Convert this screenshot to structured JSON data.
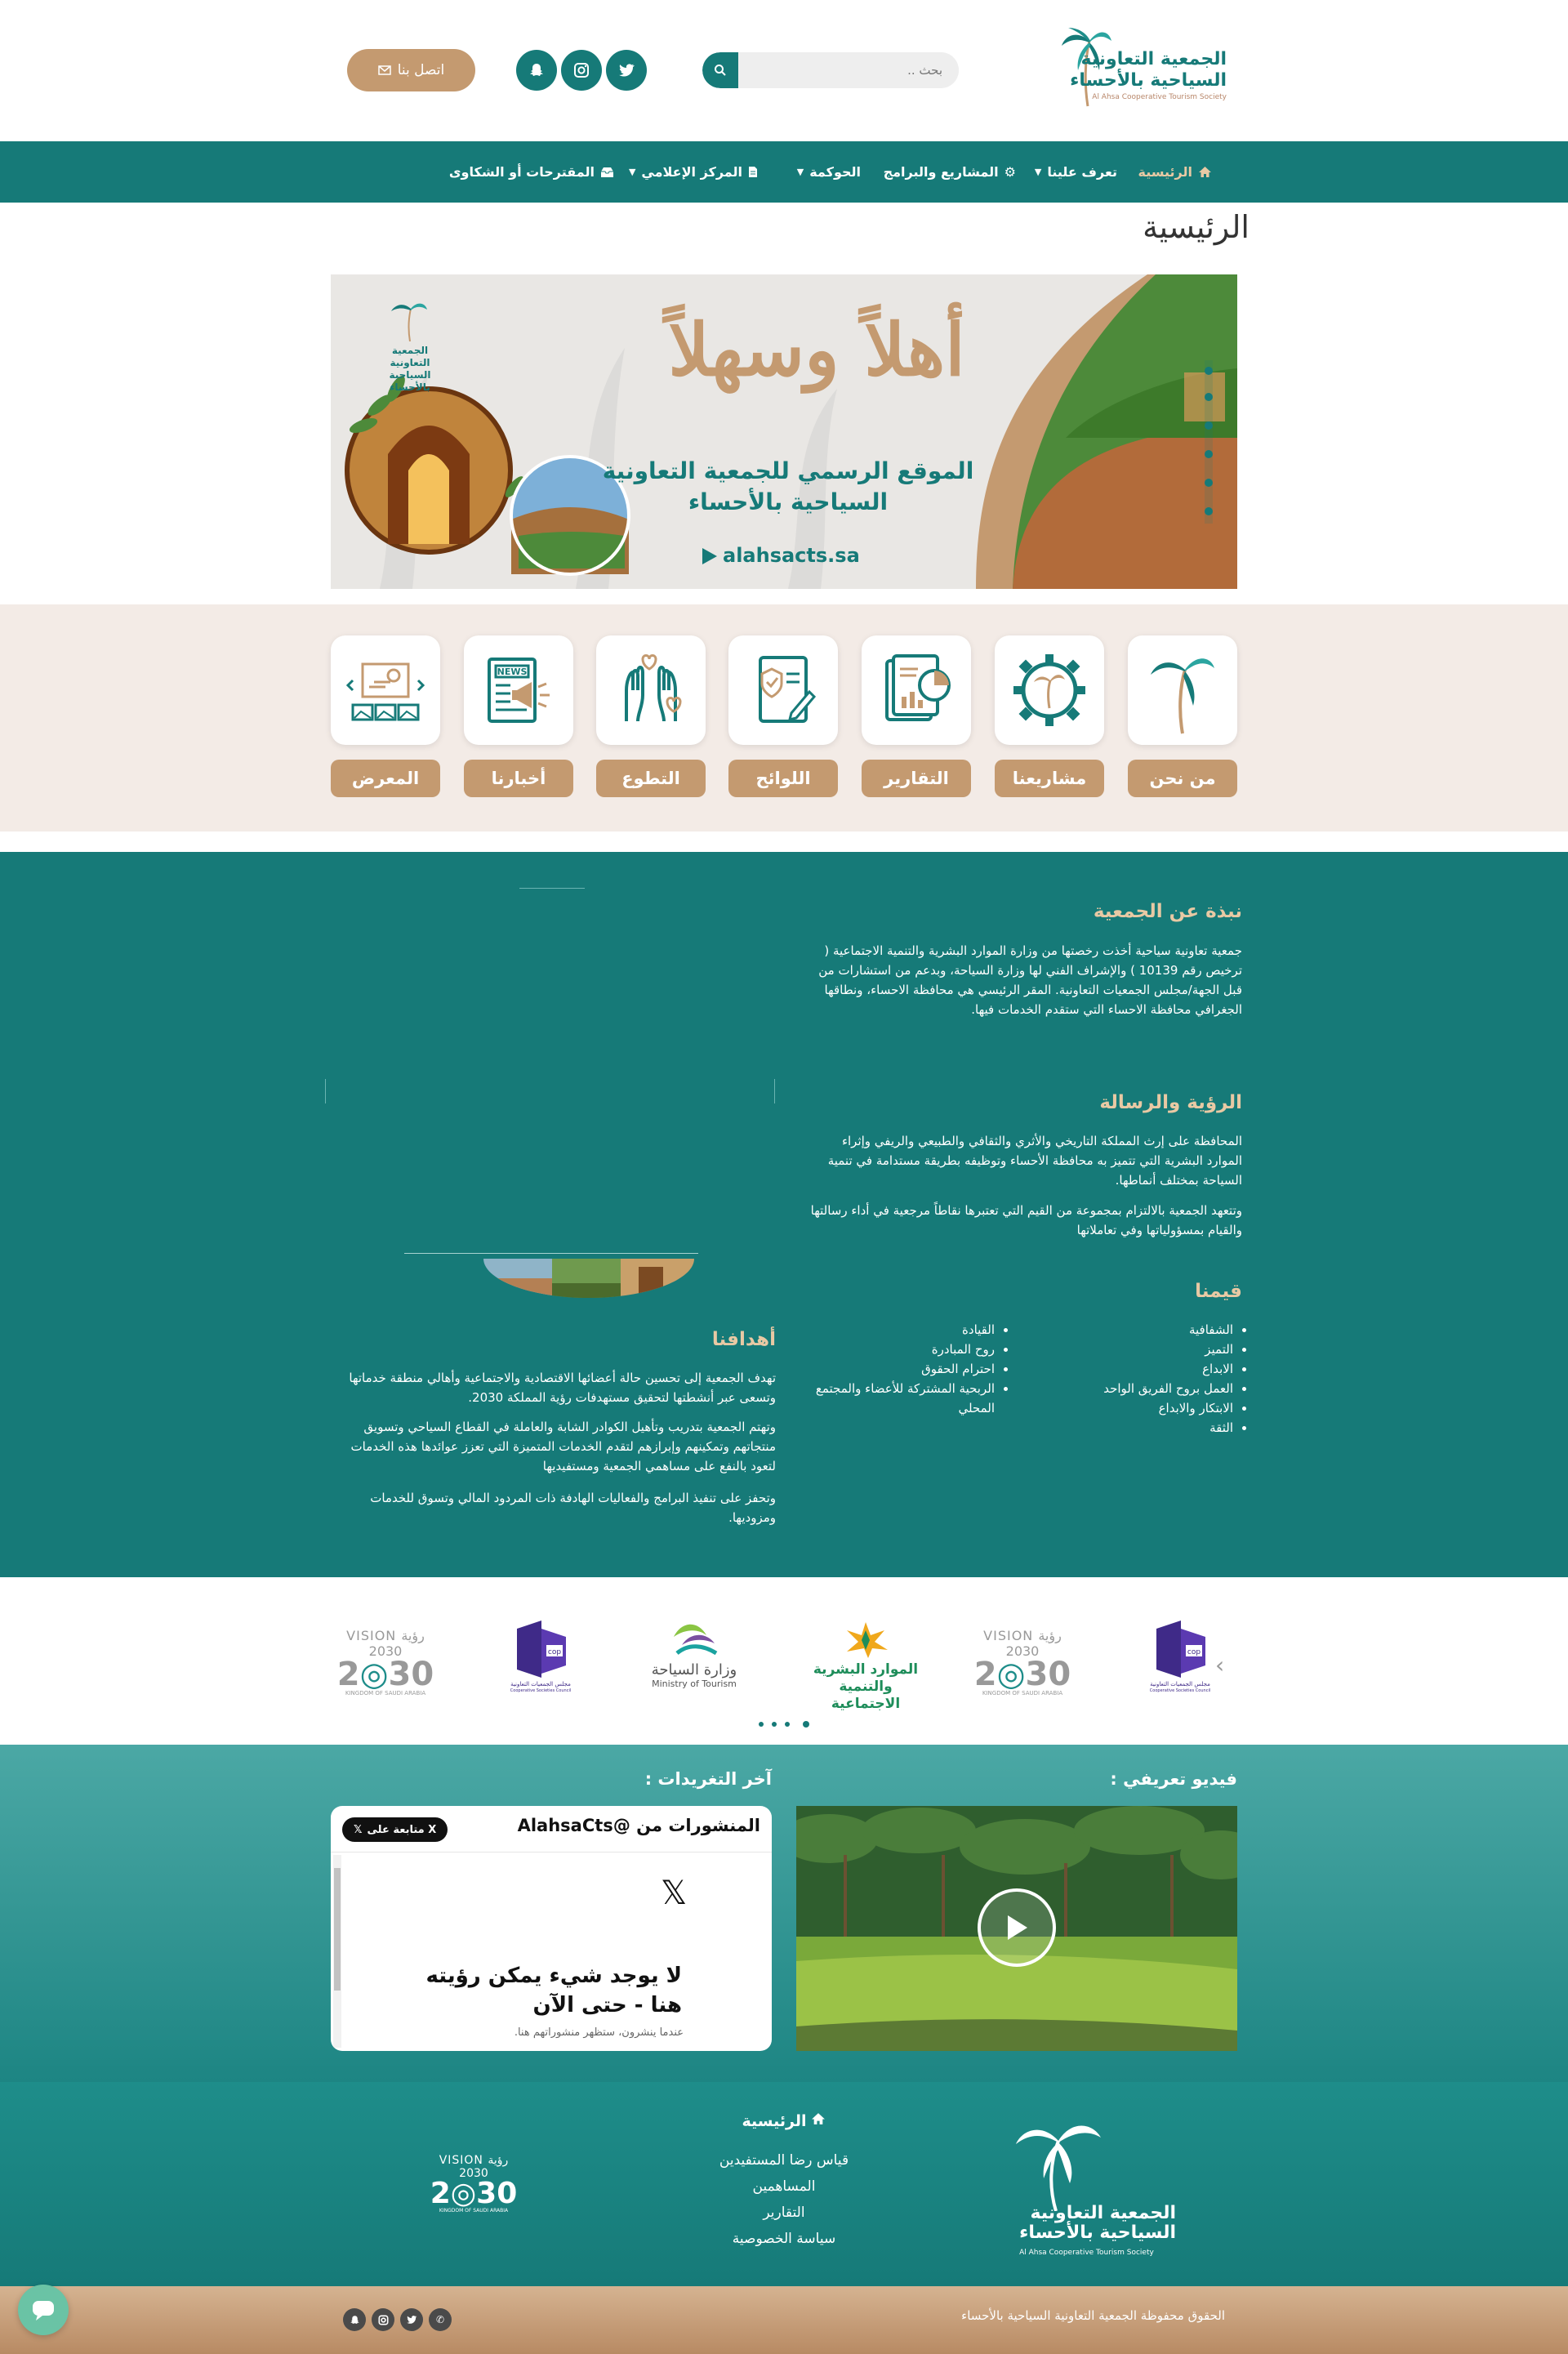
{
  "header": {
    "logo_title_line1": "الجمعية التعاونية",
    "logo_title_line2": "السياحية بالأحساء",
    "logo_subtitle": "Al Ahsa Cooperative Tourism Society",
    "search_placeholder": "بحث ..",
    "contact_label": "اتصل بنا"
  },
  "nav": {
    "items": [
      {
        "label": "الرئيسية"
      },
      {
        "label": "تعرف علينا"
      },
      {
        "label": "المشاريع والبرامج"
      },
      {
        "label": "الحوكمة"
      },
      {
        "label": "المركز الإعلامي"
      },
      {
        "label": "المقترحات أو الشكاوى"
      }
    ]
  },
  "page_title": "الرئيسية",
  "banner": {
    "headline": "أهلاً وسهلاً",
    "line1": "الموقع الرسمي للجمعية التعاونية",
    "line2": "السياحية بالأحساء",
    "url": "alahsacts.sa",
    "logo_line1": "الجمعية التعاونية",
    "logo_line2": "السياحية بالأحساء"
  },
  "quick_links": [
    {
      "label": "من نحن"
    },
    {
      "label": "مشاريعنا"
    },
    {
      "label": "التقارير"
    },
    {
      "label": "اللوائح"
    },
    {
      "label": "التطوع"
    },
    {
      "label": "أخبارنا"
    },
    {
      "label": "المعرض"
    }
  ],
  "about": {
    "title": "نبذة عن الجمعية",
    "text": "جمعية تعاونية سياحية أخذت رخصتها من وزارة الموارد البشرية والتنمية الاجتماعية ( ترخيص رقم 10139 ) والإشراف الفني لها وزارة السياحة، وبدعم من استشارات من قبل الجهة/مجلس الجمعيات التعاونية. المقر الرئيسي هي محافظة الاحساء، ونطاقها الجغرافي محافظة الاحساء التي ستقدم الخدمات فيها.",
    "vision_title": "الرؤية والرسالة",
    "vision_text1": "المحافظة على إرث المملكة التاريخي والأثري والثقافي والطبيعي والريفي وإثراء الموارد البشرية التي تتميز به محافظة الأحساء وتوظيفه بطريقة مستدامة في تنمية السياحة بمختلف أنماطها.",
    "vision_text2": "وتتعهد الجمعية بالالتزام بمجموعة من القيم التي تعتبرها نقاطاً مرجعية في أداء رسالتها والقيام بمسؤولياتها وفي تعاملاتها",
    "values_title": "قيمنا",
    "values_col1": [
      "الشفافية",
      "التميز",
      "الابداع",
      "العمل بروح الفريق الواحد",
      "الابتكار والابداع",
      "الثقة"
    ],
    "values_col2": [
      "القيادة",
      "روح المبادرة",
      "احترام الحقوق",
      "الربحية المشتركة للأعضاء والمجتمع المحلي"
    ],
    "goals_title": "أهدافنا",
    "goals_text1": "تهدف الجمعية إلى تحسين حالة أعضائها الاقتصادية والاجتماعية وأهالي منطقة خدماتها وتسعى عبر أنشطتها لتحقيق مستهدفات رؤية المملكة 2030.",
    "goals_text2": "وتهتم الجمعية بتدريب وتأهيل الكوادر الشابة والعاملة في القطاع السياحي وتسويق منتجاتهم وتمكينهم وإبرازهم لتقدم الخدمات المتميزة التي تعزز عوائدها هذه الخدمات لتعود بالنفع على مساهمي الجمعية ومستفيديها",
    "goals_text3": "وتحفز على تنفيذ البرامج والفعاليات الهادفة ذات المردود المالي وتسوق للخدمات ومزوديها."
  },
  "partners": [
    {
      "name": "مجلس الجمعيات التعاونية",
      "sub": "Cooperative Societies Council"
    },
    {
      "name": "VISION رؤية 2030",
      "sub": "KINGDOM OF SAUDI ARABIA"
    },
    {
      "name": "الموارد البشرية والتنمية الاجتماعية",
      "sub": ""
    },
    {
      "name": "وزارة السياحة",
      "sub": "Ministry of Tourism"
    },
    {
      "name": "مجلس الجمعيات التعاونية",
      "sub": "Cooperative Societies Council"
    },
    {
      "name": "VISION رؤية 2030",
      "sub": "KINGDOM OF SAUDI ARABIA"
    }
  ],
  "media": {
    "video_title": "فيديو تعريفي :",
    "tweets_title": "آخر التغريدات :",
    "tw_header": "المنشورات من @AlahsaCts",
    "tw_follow": "متابعة على X",
    "tw_empty": "لا يوجد شيء يمكن رؤيته هنا - حتى الآن",
    "tw_empty_sub": "عندما ينشرون، ستظهر منشوراتهم هنا."
  },
  "footer": {
    "home": "الرئيسية",
    "links": [
      "قياس رضا المستفيدين",
      "المساهمين",
      "التقارير",
      "سياسة الخصوصية"
    ],
    "copyright": "الحقوق محفوظة الجمعية التعاونية السياحية بالأحساء"
  },
  "colors": {
    "teal": "#167a78",
    "gold": "#c49a70",
    "beige": "#f3ebe6"
  }
}
